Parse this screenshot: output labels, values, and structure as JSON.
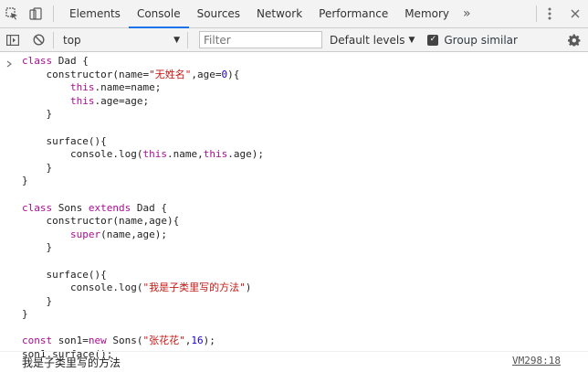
{
  "tabs": {
    "items": [
      "Elements",
      "Console",
      "Sources",
      "Network",
      "Performance",
      "Memory"
    ],
    "active": "Console",
    "more_label": "»"
  },
  "toolbar": {
    "context": "top",
    "filter_placeholder": "Filter",
    "levels_label": "Default levels",
    "group_similar_label": "Group similar",
    "group_similar_checked": true
  },
  "console": {
    "code_lines": [
      "class Dad {",
      "    constructor(name=\"无姓名\",age=0){",
      "        this.name=name;",
      "        this.age=age;",
      "    }",
      "",
      "    surface(){",
      "        console.log(this.name,this.age);",
      "    }",
      "}",
      "",
      "class Sons extends Dad {",
      "    constructor(name,age){",
      "        super(name,age);",
      "    }",
      "",
      "    surface(){",
      "        console.log(\"我是子类里写的方法\")",
      "    }",
      "}",
      "",
      "const son1=new Sons(\"张花花\",16);",
      "son1.surface();"
    ],
    "output_text": "我是子类里写的方法",
    "output_source": "VM298:18"
  },
  "colors": {
    "keyword": "#aa0d91",
    "string": "#c41a16",
    "number": "#1c00cf",
    "active_tab_underline": "#1a73e8"
  },
  "icons": {
    "inspect": "inspect-element-icon",
    "device": "device-toolbar-icon",
    "sidebar": "console-sidebar-icon",
    "clear": "clear-console-icon",
    "settings": "gear-icon",
    "menu": "kebab-menu-icon",
    "close": "close-icon",
    "prompt": "prompt-chevron-icon"
  }
}
